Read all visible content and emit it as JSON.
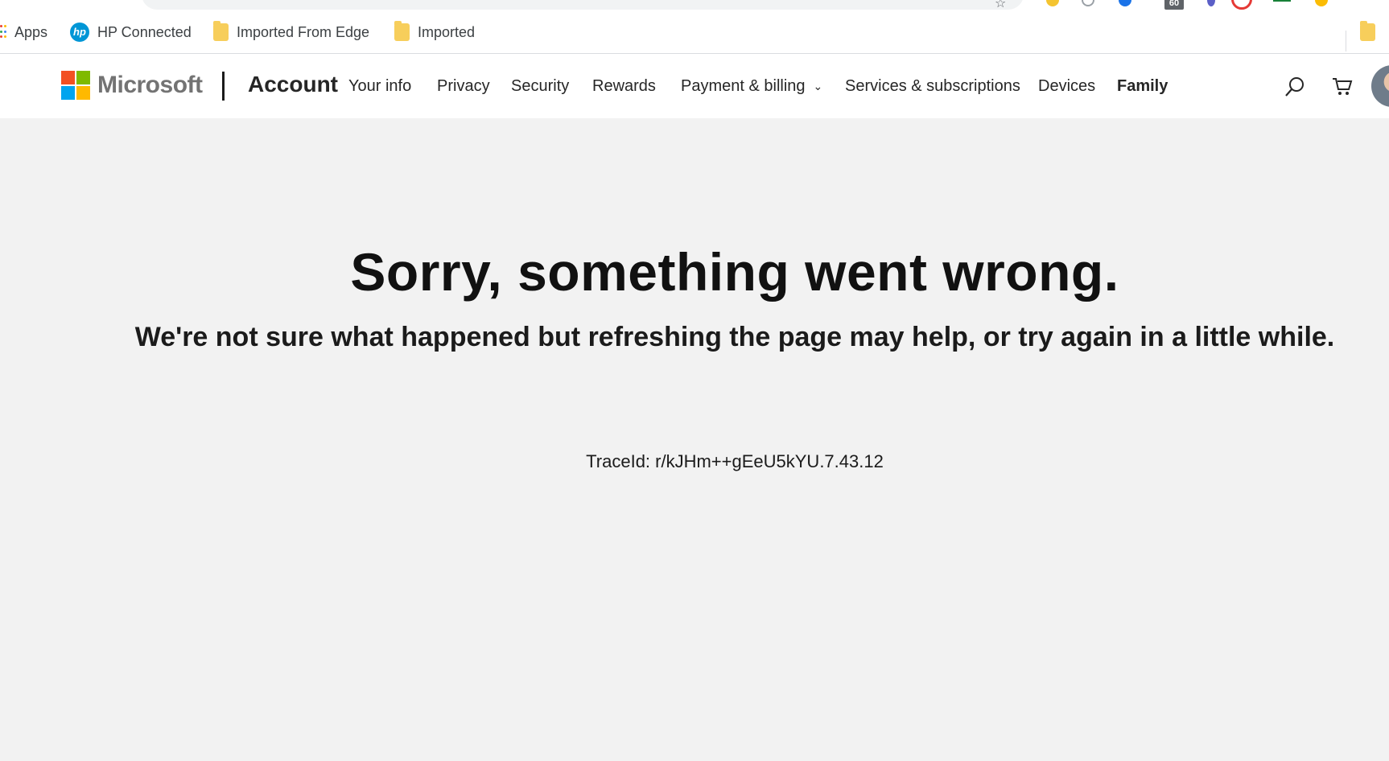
{
  "browser": {
    "extension_badge": "60"
  },
  "bookmarks": {
    "items": [
      {
        "label": "Apps",
        "icon": "apps-grid-icon"
      },
      {
        "label": "HP Connected",
        "icon": "hp-logo-icon",
        "icon_text": "hp"
      },
      {
        "label": "Imported From Edge",
        "icon": "folder-icon"
      },
      {
        "label": "Imported",
        "icon": "folder-icon"
      }
    ]
  },
  "header": {
    "brand": "Microsoft",
    "product": "Account",
    "nav": [
      {
        "label": "Your info"
      },
      {
        "label": "Privacy"
      },
      {
        "label": "Security"
      },
      {
        "label": "Rewards"
      },
      {
        "label": "Payment & billing",
        "has_dropdown": true
      },
      {
        "label": "Services & subscriptions"
      },
      {
        "label": "Devices"
      },
      {
        "label": "Family",
        "active": true
      }
    ]
  },
  "error": {
    "title": "Sorry, something went wrong.",
    "message": "We're not sure what happened but refreshing the page may help, or try again in a little while.",
    "trace": "TraceId: r/kJHm++gEeU5kYU.7.43.12"
  },
  "colors": {
    "page_background": "#f2f2f2",
    "header_background": "#ffffff",
    "ms_red": "#f25022",
    "ms_green": "#7fba00",
    "ms_blue": "#00a4ef",
    "ms_yellow": "#ffb900",
    "folder": "#f7ce5b",
    "hp_blue": "#0096d6"
  }
}
